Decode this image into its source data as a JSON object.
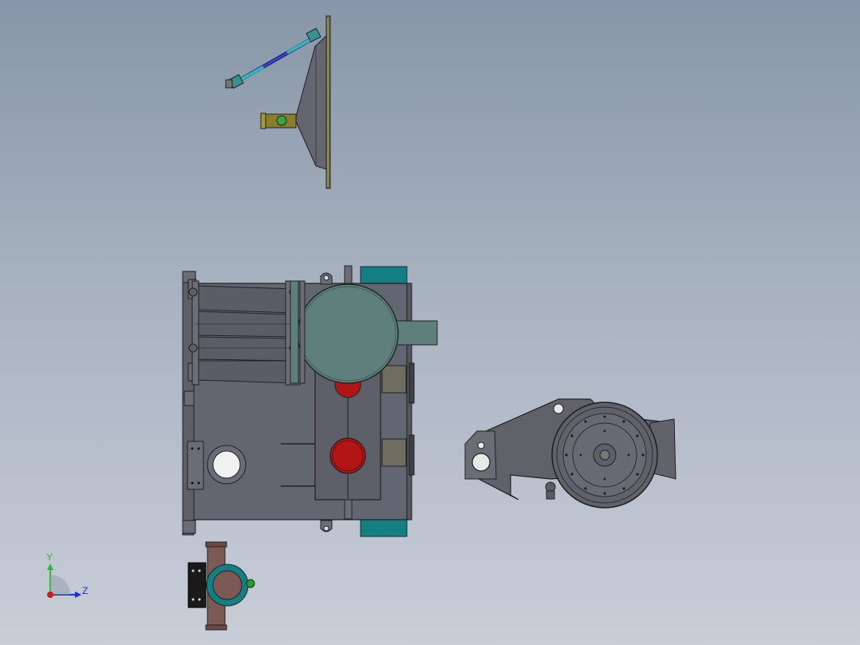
{
  "viewport": {
    "background_top": "#8796a8",
    "background_bottom": "#c9ced8"
  },
  "triad": {
    "y_label": "Y",
    "z_label": "Z",
    "y_color": "#2fb52f",
    "z_color": "#1a2fd6",
    "x_color": "#d01a1a"
  },
  "colors": {
    "body": "#626670",
    "body_dark": "#4c5059",
    "teal": "#127f82",
    "tank": "#5e7f7b",
    "red": "#b11515",
    "bronze": "#7b5a56",
    "yellow": "#9e9a2a"
  }
}
